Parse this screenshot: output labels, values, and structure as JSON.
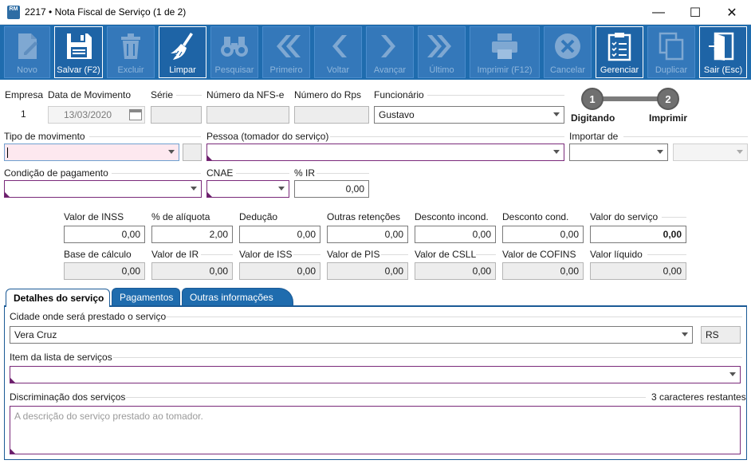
{
  "window": {
    "title": "2217 • Nota Fiscal de Serviço (1 de 2)",
    "app_icon_text": "RM",
    "minimize_glyph": "—",
    "maximize_glyph": "☐",
    "close_glyph": "✕"
  },
  "toolbar": {
    "novo": "Novo",
    "salvar": "Salvar (F2)",
    "excluir": "Excluir",
    "limpar": "Limpar",
    "pesquisar": "Pesquisar",
    "primeiro": "Primeiro",
    "voltar": "Voltar",
    "avancar": "Avançar",
    "ultimo": "Último",
    "imprimir": "Imprimir (F12)",
    "cancelar": "Cancelar",
    "gerenciar": "Gerenciar",
    "duplicar": "Duplicar",
    "sair": "Sair (Esc)"
  },
  "header": {
    "empresa_label": "Empresa",
    "empresa_value": "1",
    "data_label": "Data de Movimento",
    "data_value": "13/03/2020",
    "serie_label": "Série",
    "serie_value": "",
    "nfse_label": "Número da NFS-e",
    "nfse_value": "",
    "rps_label": "Número do Rps",
    "rps_value": "",
    "funcionario_label": "Funcionário",
    "funcionario_value": "Gustavo"
  },
  "steps": [
    {
      "number": "1",
      "label": "Digitando"
    },
    {
      "number": "2",
      "label": "Imprimir"
    }
  ],
  "row2": {
    "tipo_label": "Tipo de movimento",
    "tipo_value": "",
    "tipo_code": "",
    "pessoa_label": "Pessoa (tomador do serviço)",
    "pessoa_value": "",
    "importar_label": "Importar de",
    "importar_value": "",
    "importar_value2": ""
  },
  "row3": {
    "condicao_label": "Condição de pagamento",
    "condicao_value": "",
    "cnae_label": "CNAE",
    "cnae_value": "",
    "ir_label": "% IR",
    "ir_value": "0,00"
  },
  "values_row1": [
    {
      "label": "Valor de INSS",
      "value": "0,00"
    },
    {
      "label": "% de alíquota",
      "value": "2,00"
    },
    {
      "label": "Dedução",
      "value": "0,00"
    },
    {
      "label": "Outras retenções",
      "value": "0,00"
    },
    {
      "label": "Desconto incond.",
      "value": "0,00"
    },
    {
      "label": "Desconto cond.",
      "value": "0,00"
    },
    {
      "label": "Valor do serviço",
      "value": "0,00"
    }
  ],
  "values_row2": [
    {
      "label": "Base de cálculo",
      "value": "0,00"
    },
    {
      "label": "Valor de IR",
      "value": "0,00"
    },
    {
      "label": "Valor de ISS",
      "value": "0,00"
    },
    {
      "label": "Valor de PIS",
      "value": "0,00"
    },
    {
      "label": "Valor de CSLL",
      "value": "0,00"
    },
    {
      "label": "Valor de COFINS",
      "value": "0,00"
    },
    {
      "label": "Valor líquido",
      "value": "0,00"
    }
  ],
  "tabs": [
    {
      "label": "Detalhes do serviço"
    },
    {
      "label": "Pagamentos"
    },
    {
      "label": "Outras informações"
    }
  ],
  "details": {
    "cidade_label": "Cidade onde será prestado o serviço",
    "cidade_value": "Vera Cruz",
    "uf_value": "RS",
    "item_label": "Item da lista de serviços",
    "item_value": "",
    "discriminacao_label": "Discriminação dos serviços",
    "caracteres_restantes": "3 caracteres restantes",
    "discriminacao_placeholder": "A descrição do serviço prestado ao tomador."
  },
  "colors": {
    "toolbar": "#1f6cae",
    "required_marker": "#6a1f6a",
    "step_grey": "#707070"
  }
}
